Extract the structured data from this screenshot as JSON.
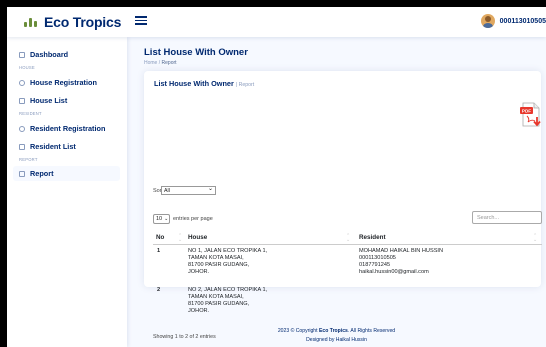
{
  "brand": {
    "name": "Eco Tropics"
  },
  "header": {
    "user_id": "000113010505"
  },
  "sidebar": {
    "items": [
      {
        "label": "Dashboard",
        "heading": ""
      },
      {
        "label": "House Registration",
        "heading": "House"
      },
      {
        "label": "House List",
        "heading": ""
      },
      {
        "label": "Resident Registration",
        "heading": "Resident"
      },
      {
        "label": "Resident List",
        "heading": ""
      },
      {
        "label": "Report",
        "heading": "Report"
      }
    ]
  },
  "page": {
    "title": "List House With Owner",
    "breadcrumb_home": "Home",
    "breadcrumb_sep": " / ",
    "breadcrumb_current": "Report"
  },
  "card": {
    "title": "List House With Owner",
    "subtitle": "| Report",
    "pdf_icon": "pdf-download-icon",
    "sort_label": "Sort :",
    "sort_value": "All",
    "page_length": "10",
    "page_length_label": "entries per page",
    "search_placeholder": "Search...",
    "columns": [
      "No",
      "House",
      "Resident"
    ],
    "rows": [
      {
        "no": "1",
        "house": [
          "NO 1, JALAN ECO TROPIKA 1,",
          "TAMAN KOTA MASAI,",
          "81700 PASIR GUDANG,",
          "JOHOR."
        ],
        "resident": [
          "MOHAMAD HAIKAL BIN HUSSIN",
          "000113010505",
          "0187791245",
          "haikal.hussin00@gmail.com"
        ]
      },
      {
        "no": "2",
        "house": [
          "NO 2, JALAN ECO TROPIKA 1,",
          "TAMAN KOTA MASAI,",
          "81700 PASIR GUDANG,",
          "JOHOR."
        ],
        "resident": []
      }
    ],
    "info": "Showing 1 to 2 of 2 entries"
  },
  "footer": {
    "copyright_prefix": "2023 © Copyright",
    "copyright_brand": "Eco Tropics",
    "copyright_suffix": ". All Rights Reserved",
    "designed_by": "Designed by Haikal Hussin"
  },
  "colors": {
    "primary": "#012970",
    "muted": "#899bbd",
    "background": "#f6f9ff",
    "pdf_red": "#e8372c"
  }
}
